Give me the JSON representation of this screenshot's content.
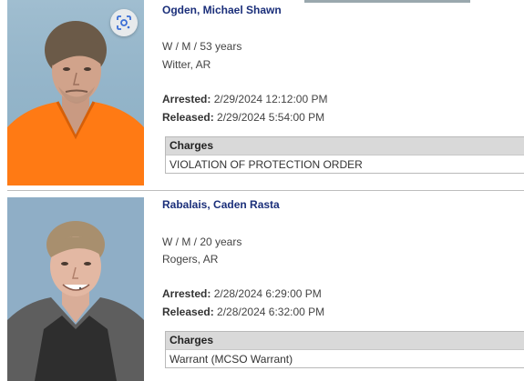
{
  "records": [
    {
      "name": "Ogden, Michael Shawn",
      "demographics": "W / M / 53 years",
      "city": "Witter, AR",
      "arrested_label": "Arrested:",
      "arrested": "2/29/2024 12:12:00 PM",
      "released_label": "Released:",
      "released": "2/29/2024 5:54:00 PM",
      "charges_header": "Charges",
      "charges": [
        "VIOLATION OF PROTECTION ORDER"
      ]
    },
    {
      "name": "Rabalais, Caden Rasta",
      "demographics": "W / M / 20 years",
      "city": "Rogers, AR",
      "arrested_label": "Arrested:",
      "arrested": "2/28/2024 6:29:00 PM",
      "released_label": "Released:",
      "released": "2/28/2024 6:32:00 PM",
      "charges_header": "Charges",
      "charges": [
        "Warrant (MCSO Warrant)"
      ]
    }
  ],
  "icons": {
    "lens": "google-lens-icon"
  },
  "colors": {
    "name": "#1b2f7a",
    "charges_header_bg": "#d9d9d9",
    "mugshot1_shirt": "#ff7a14",
    "mugshot_bg": "#8fb0c8"
  }
}
